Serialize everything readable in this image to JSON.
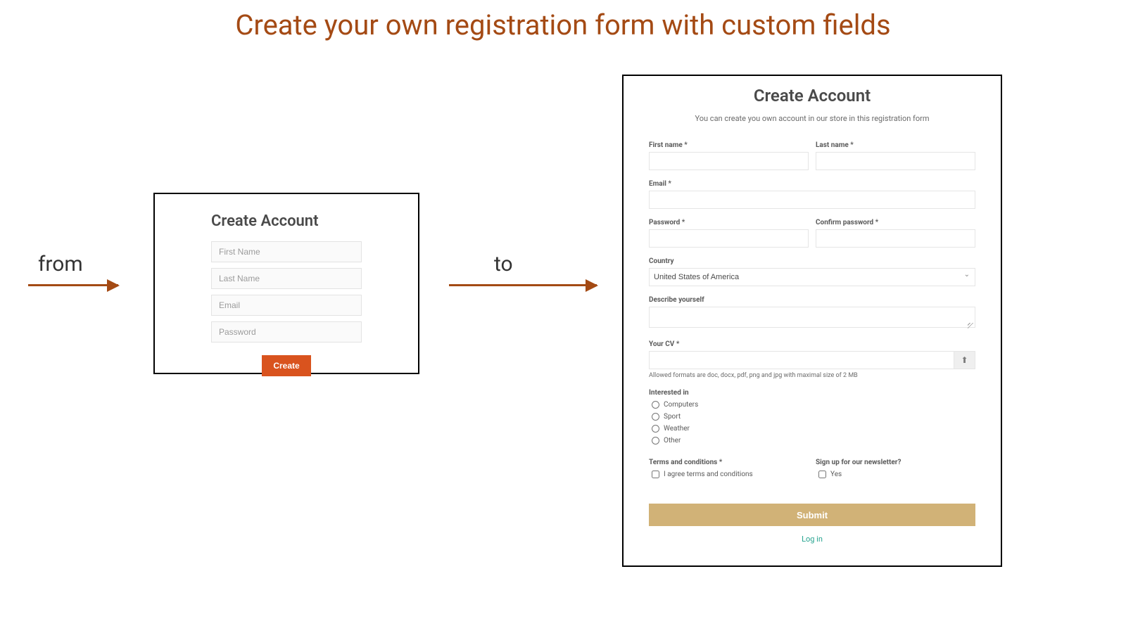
{
  "headline": "Create your own registration form with custom fields",
  "labels": {
    "from": "from",
    "to": "to"
  },
  "simple": {
    "title": "Create Account",
    "first_name_placeholder": "First Name",
    "last_name_placeholder": "Last Name",
    "email_placeholder": "Email",
    "password_placeholder": "Password",
    "create_button": "Create"
  },
  "advanced": {
    "title": "Create Account",
    "subtitle": "You can create you own account in our store in this registration form",
    "first_name_label": "First name *",
    "last_name_label": "Last name *",
    "email_label": "Email *",
    "password_label": "Password *",
    "confirm_password_label": "Confirm password *",
    "country_label": "Country",
    "country_value": "United States of America",
    "describe_label": "Describe yourself",
    "cv_label": "Your CV *",
    "cv_help": "Allowed formats are doc, docx, pdf, png and jpg with maximal size of 2 MB",
    "interested_label": "Interested in",
    "interested_options": [
      "Computers",
      "Sport",
      "Weather",
      "Other"
    ],
    "terms_label": "Terms and conditions *",
    "terms_checkbox": "I agree terms and conditions",
    "newsletter_label": "Sign up for our newsletter?",
    "newsletter_checkbox": "Yes",
    "submit_button": "Submit",
    "login_link": "Log in"
  }
}
